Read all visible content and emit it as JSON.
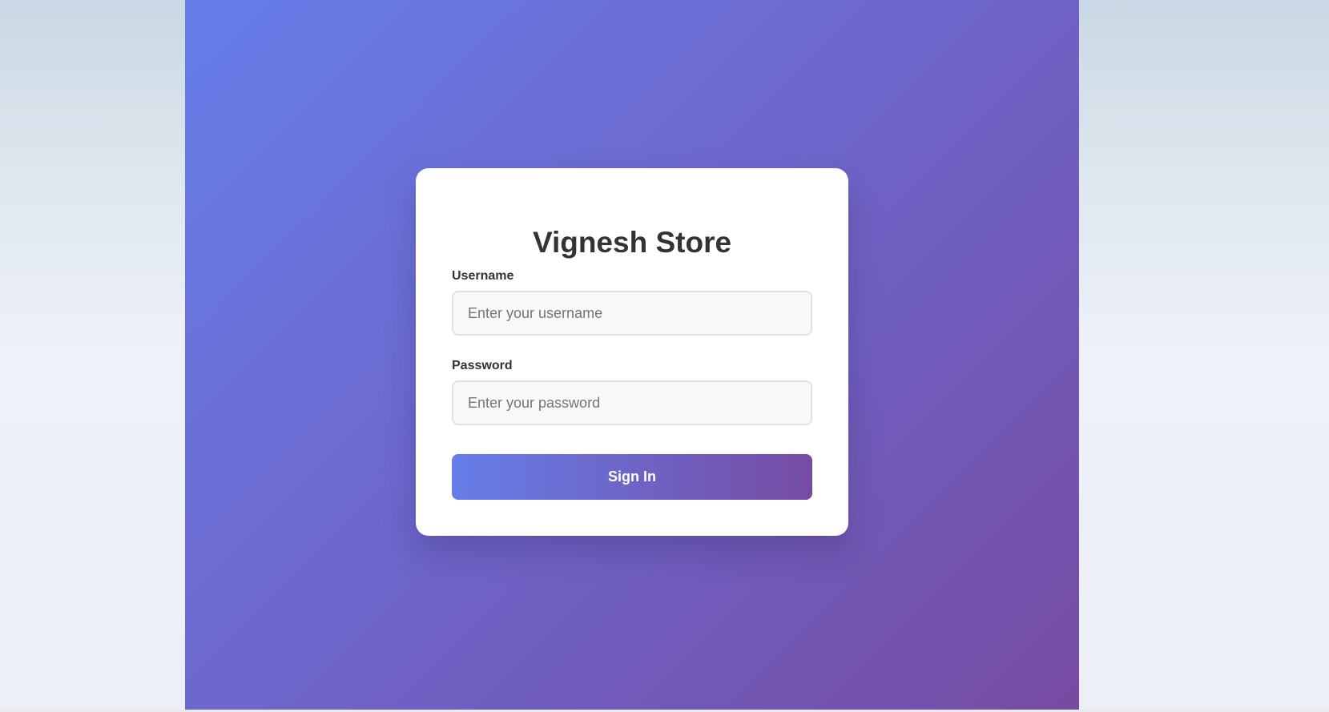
{
  "store": {
    "title": "Vignesh Store"
  },
  "form": {
    "username_label": "Username",
    "username_placeholder": "Enter your username",
    "username_value": "",
    "password_label": "Password",
    "password_placeholder": "Enter your password",
    "password_value": "",
    "submit_label": "Sign In"
  },
  "colors": {
    "gradient_start": "#667eea",
    "gradient_end": "#764ba2",
    "card_background": "#ffffff",
    "text": "#333333"
  }
}
